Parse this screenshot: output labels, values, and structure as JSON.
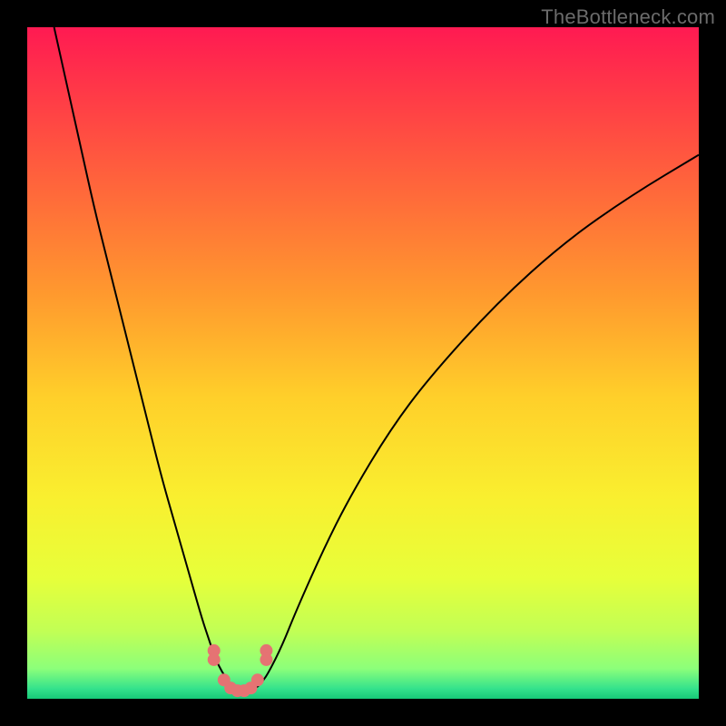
{
  "watermark": "TheBottleneck.com",
  "colors": {
    "background": "#000000",
    "curve_stroke": "#000000",
    "marker_fill": "#e57373",
    "gradient_stops": [
      {
        "offset": 0.0,
        "color": "#ff1a52"
      },
      {
        "offset": 0.1,
        "color": "#ff3a47"
      },
      {
        "offset": 0.25,
        "color": "#ff6a3a"
      },
      {
        "offset": 0.4,
        "color": "#ff9a2e"
      },
      {
        "offset": 0.55,
        "color": "#ffcf2a"
      },
      {
        "offset": 0.7,
        "color": "#f9ef2f"
      },
      {
        "offset": 0.82,
        "color": "#e7ff3a"
      },
      {
        "offset": 0.9,
        "color": "#c1ff55"
      },
      {
        "offset": 0.955,
        "color": "#8cff7a"
      },
      {
        "offset": 0.985,
        "color": "#34e28c"
      },
      {
        "offset": 1.0,
        "color": "#17c877"
      }
    ]
  },
  "chart_data": {
    "type": "line",
    "title": "",
    "xlabel": "",
    "ylabel": "",
    "xlim": [
      0,
      100
    ],
    "ylim": [
      0,
      100
    ],
    "grid": false,
    "series": [
      {
        "name": "bottleneck-curve",
        "x": [
          4,
          6,
          8,
          10,
          12,
          14,
          16,
          18,
          20,
          22,
          24,
          26,
          27,
          28,
          29,
          30,
          31,
          32,
          33,
          34,
          35,
          36,
          38,
          40,
          44,
          48,
          54,
          60,
          70,
          80,
          90,
          100
        ],
        "y": [
          100,
          91,
          82,
          73,
          65,
          57,
          49,
          41,
          33,
          26,
          19,
          12,
          9,
          6,
          4,
          2.5,
          1.5,
          1,
          1,
          1.5,
          2.5,
          4,
          8,
          13,
          22,
          30,
          40,
          48,
          59,
          68,
          75,
          81
        ]
      }
    ],
    "markers": {
      "name": "highlight-markers",
      "x": [
        27.8,
        29.3,
        30.3,
        31.3,
        32.3,
        33.3,
        34.3,
        35.6
      ],
      "y": [
        6.5,
        2.8,
        1.6,
        1.2,
        1.2,
        1.6,
        2.8,
        6.5
      ],
      "style": "double-circle"
    }
  }
}
